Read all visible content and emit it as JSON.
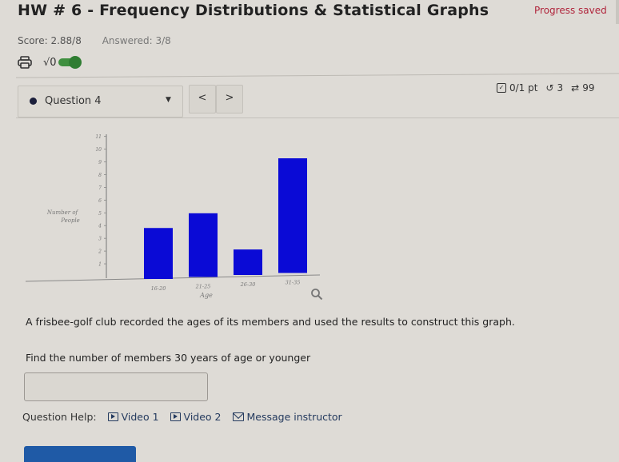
{
  "header": {
    "title": "HW # 6 - Frequency Distributions & Statistical Graphs",
    "progress_status": "Progress saved",
    "score": "Score: 2.88/8",
    "answered": "Answered: 3/8",
    "tools": {
      "print_icon": "printer-icon",
      "math_icon": "√0"
    }
  },
  "question_nav": {
    "selected": "Question 4",
    "prev": "<",
    "next": ">",
    "points": "0/1 pt",
    "retries": "3",
    "attempts": "99"
  },
  "chart_data": {
    "type": "bar",
    "title": "",
    "xlabel": "Age",
    "ylabel": "Number of People",
    "categories": [
      "16-20",
      "21-25",
      "26-30",
      "31-35"
    ],
    "values": [
      4,
      5,
      2,
      9
    ],
    "yticks": [
      1,
      2,
      3,
      4,
      5,
      6,
      7,
      8,
      9,
      10,
      11
    ],
    "ylim": [
      0,
      11
    ],
    "grid": false,
    "bar_color": "#0a0ad6"
  },
  "problem": {
    "text": "A frisbee-golf club recorded the ages of its members and used the results to construct this graph.",
    "question": "Find the number of members 30 years of age or younger",
    "answer_value": ""
  },
  "help": {
    "label": "Question Help:",
    "video1": "Video 1",
    "video2": "Video 2",
    "message": "Message instructor"
  }
}
